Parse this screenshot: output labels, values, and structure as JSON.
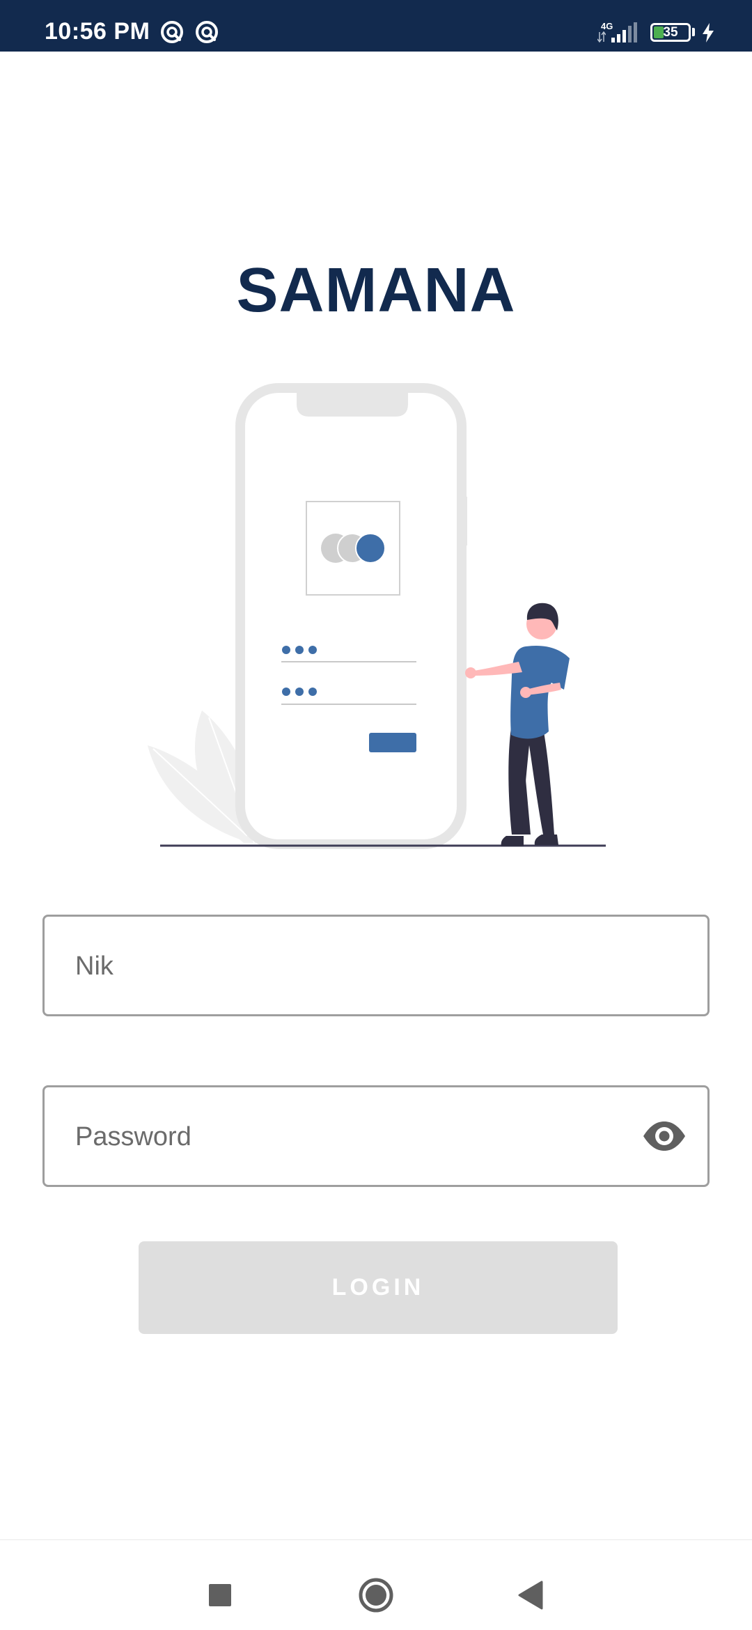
{
  "status_bar": {
    "time": "10:56 PM",
    "network_type": "4G",
    "battery_level": "35",
    "background_color": "#122a4e"
  },
  "app": {
    "title": "SAMANA",
    "brand_color": "#122a4e",
    "accent_color": "#3e6ea8"
  },
  "form": {
    "nik_placeholder": "Nik",
    "nik_value": "",
    "password_placeholder": "Password",
    "password_value": "",
    "password_toggle_icon": "eye-icon",
    "login_label": "LOGIN",
    "login_enabled": false
  },
  "nav_bar": {
    "recents_icon": "square-icon",
    "home_icon": "circle-icon",
    "back_icon": "triangle-back-icon"
  }
}
